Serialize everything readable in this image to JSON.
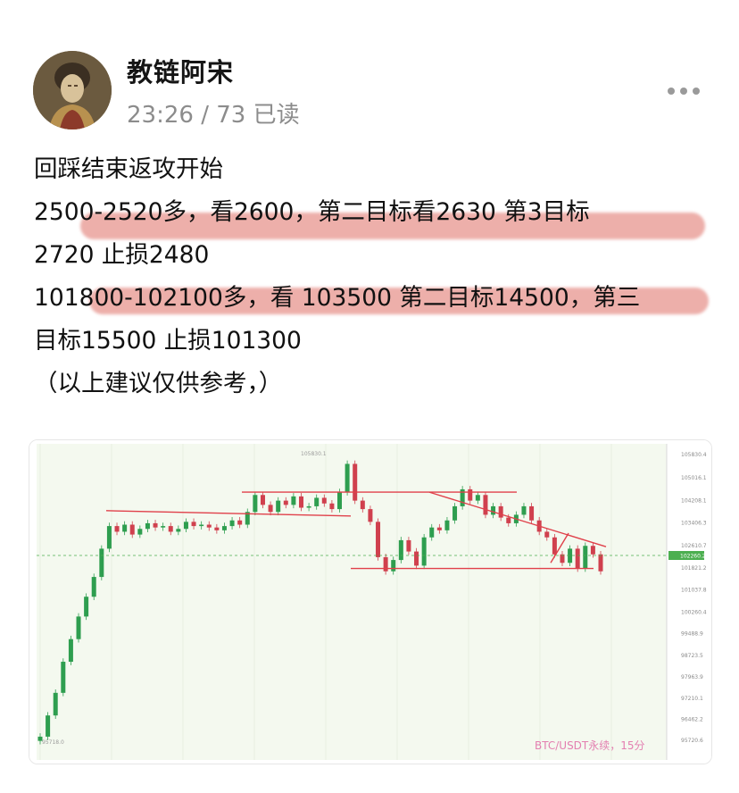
{
  "author": {
    "name": "教链阿宋",
    "meta": "23:26 / 73 已读"
  },
  "post": {
    "lines": [
      "回踩结束返攻开始",
      "2500-2520多，看2600，第二目标看2630 第3目标",
      "2720  止损2480",
      "101800-102100多，看 103500 第二目标14500，第三",
      "目标15500 止损101300",
      "（以上建议仅供参考，）"
    ]
  },
  "icons": {
    "more": "more-dots-icon",
    "avatar": "avatar-image"
  },
  "colors": {
    "highlight": "#de6e64",
    "candle_up": "#2e9e4f",
    "candle_down": "#d0404e",
    "trendline": "#e0404a",
    "current_price_line": "#4caf50",
    "chart_bg": "#f4f9ef"
  },
  "chart": {
    "watermark": "BTC/USDT永续，15分",
    "high_label": "105830.1",
    "low_label": "95718.0",
    "y_ticks": [
      "105830.4",
      "105016.1",
      "104208.1",
      "103406.3",
      "102610.7",
      "101821.2",
      "101037.8",
      "100260.4",
      "99488.9",
      "98723.5",
      "97963.9",
      "97210.1",
      "96462.2",
      "95720.6"
    ],
    "current_price": "102260.2"
  },
  "chart_data": {
    "type": "line",
    "title": "",
    "xlabel": "",
    "ylabel": "",
    "ylim": [
      95720.6,
      105830.4
    ],
    "series": [
      {
        "values": [
          95850,
          96600,
          97400,
          98500,
          99300,
          100100,
          100800,
          101500,
          102500,
          103300,
          103100,
          103350,
          103000,
          103200,
          103400,
          103250,
          103300,
          103100,
          103200,
          103450,
          103300,
          103350,
          103250,
          103150,
          103300,
          103500,
          103350,
          103800,
          104400,
          104050,
          103800,
          104200,
          104050,
          104350,
          103950,
          104000,
          104300,
          104100,
          103900,
          104500,
          105500,
          104200,
          103900,
          103450,
          102200,
          101700,
          102100,
          102800,
          102400,
          101900,
          102900,
          103250,
          103150,
          103500,
          104000,
          104600,
          104200,
          104400,
          103700,
          104000,
          103600,
          103400,
          103700,
          104000,
          103500,
          103100,
          102900,
          102300,
          102000,
          102500,
          101800,
          102600,
          102300,
          101700
        ]
      }
    ],
    "annotations": {
      "horizontal_levels": [
        103750,
        104500,
        101800
      ],
      "descending_trendline": [
        [
          104500,
          102950
        ]
      ],
      "projected_move": "up"
    }
  }
}
